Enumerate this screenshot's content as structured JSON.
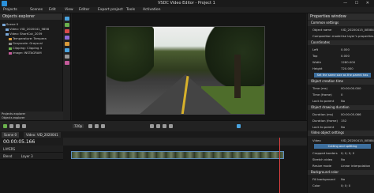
{
  "app": {
    "title": "VSDC Video Editor - Project 1"
  },
  "menu": [
    "Projects",
    "Scenes",
    "Edit",
    "View",
    "Editor",
    "Export project",
    "Tools",
    "Activation"
  ],
  "explorer": {
    "title": "Objects explorer",
    "items": [
      "Scene 0",
      "Video: VID_2020041_9858",
      "Video: ShortCut_2039",
      "Temperature: Tempera",
      "Grayscale: Grayscal",
      "Clipping: Clipping 4",
      "Image: INSTAGRAM"
    ],
    "tabs": [
      "Projects explorer",
      "Objects explorer"
    ]
  },
  "properties": {
    "title": "Properties window",
    "sections": [
      {
        "type": "section",
        "label": "Common settings"
      },
      {
        "type": "row",
        "k": "Object name",
        "v": "VID_20200415_085848"
      },
      {
        "type": "row",
        "k": "Composition mode",
        "v": "Use layer's properties"
      },
      {
        "type": "section",
        "label": "Coordinates"
      },
      {
        "type": "row",
        "k": "Left",
        "v": "0.000"
      },
      {
        "type": "row",
        "k": "Top",
        "v": "0.000"
      },
      {
        "type": "row",
        "k": "Width",
        "v": "1280.000"
      },
      {
        "type": "row",
        "k": "Height",
        "v": "720.000"
      },
      {
        "type": "button",
        "label": "Set the same size as the parent has"
      },
      {
        "type": "section",
        "label": "Object creation time"
      },
      {
        "type": "row",
        "k": "Time (ms)",
        "v": "00:00:00.000"
      },
      {
        "type": "row",
        "k": "Time (frame)",
        "v": "0"
      },
      {
        "type": "row",
        "k": "Lock to parent",
        "v": "No"
      },
      {
        "type": "section",
        "label": "Object drawing duration"
      },
      {
        "type": "row",
        "k": "Duration (ms)",
        "v": "00:00:05.066"
      },
      {
        "type": "row",
        "k": "Duration (frame)",
        "v": "152"
      },
      {
        "type": "row",
        "k": "Lock to parent",
        "v": "No"
      },
      {
        "type": "section",
        "label": "Video object settings"
      },
      {
        "type": "row",
        "k": "Video",
        "v": "VID_20200415_085848"
      },
      {
        "type": "button",
        "label": "Cutting and splitting"
      },
      {
        "type": "row",
        "k": "Cropped borders",
        "v": "0; 0; 0; 0"
      },
      {
        "type": "row",
        "k": "Stretch video",
        "v": "No"
      },
      {
        "type": "row",
        "k": "Resize mode",
        "v": "Linear interpolation"
      },
      {
        "type": "section",
        "label": "Background color"
      },
      {
        "type": "row",
        "k": "Fill background",
        "v": "No"
      },
      {
        "type": "row",
        "k": "Color",
        "v": "0; 0; 0"
      }
    ]
  },
  "transport": {
    "zoom": "720p"
  },
  "timeline": {
    "tab": "Scene 0",
    "tab2": "Video: VID_2020041",
    "timecode": "00:00:05.166",
    "layers_label": "LAYERS",
    "tracks": [
      "Blend",
      "Layer 3"
    ]
  }
}
